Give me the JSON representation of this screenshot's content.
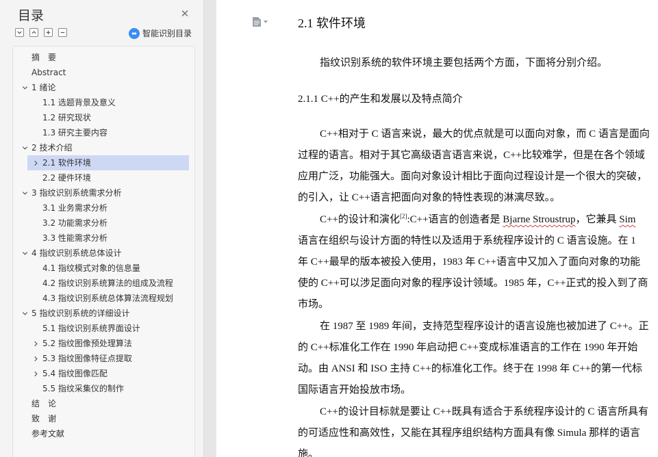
{
  "sidebar": {
    "title": "目录",
    "smart_label": "智能识别目录",
    "items": [
      {
        "label": "摘　要",
        "level": 0,
        "arrow": "none"
      },
      {
        "label": "Abstract",
        "level": 0,
        "arrow": "none"
      },
      {
        "label": "1 绪论",
        "level": 0,
        "arrow": "down"
      },
      {
        "label": "1.1 选题背景及意义",
        "level": 1,
        "arrow": "none"
      },
      {
        "label": "1.2 研究现状",
        "level": 1,
        "arrow": "none"
      },
      {
        "label": "1.3 研究主要内容",
        "level": 1,
        "arrow": "none"
      },
      {
        "label": "2 技术介绍",
        "level": 0,
        "arrow": "down"
      },
      {
        "label": "2.1 软件环境",
        "level": 1,
        "arrow": "right",
        "active": true
      },
      {
        "label": "2.2 硬件环境",
        "level": 1,
        "arrow": "none"
      },
      {
        "label": "3 指纹识别系统需求分析",
        "level": 0,
        "arrow": "down"
      },
      {
        "label": "3.1 业务需求分析",
        "level": 1,
        "arrow": "none"
      },
      {
        "label": "3.2 功能需求分析",
        "level": 1,
        "arrow": "none"
      },
      {
        "label": "3.3 性能需求分析",
        "level": 1,
        "arrow": "none"
      },
      {
        "label": "4 指纹识别系统总体设计",
        "level": 0,
        "arrow": "down"
      },
      {
        "label": "4.1 指纹模式对象的信息量",
        "level": 1,
        "arrow": "none"
      },
      {
        "label": "4.2 指纹识别系统算法的组成及流程",
        "level": 1,
        "arrow": "none"
      },
      {
        "label": "4.3 指纹识别系统总体算法流程规划",
        "level": 1,
        "arrow": "none"
      },
      {
        "label": "5 指纹识别系统的详细设计",
        "level": 0,
        "arrow": "down"
      },
      {
        "label": "5.1 指纹识别系统界面设计",
        "level": 1,
        "arrow": "none"
      },
      {
        "label": "5.2 指纹图像预处理算法",
        "level": 1,
        "arrow": "right"
      },
      {
        "label": "5.3 指纹图像特征点提取",
        "level": 1,
        "arrow": "right"
      },
      {
        "label": "5.4 指纹图像匹配",
        "level": 1,
        "arrow": "right"
      },
      {
        "label": "5.5 指纹采集仪的制作",
        "level": 1,
        "arrow": "none"
      },
      {
        "label": "结　论",
        "level": 0,
        "arrow": "none"
      },
      {
        "label": "致　谢",
        "level": 0,
        "arrow": "none"
      },
      {
        "label": "参考文献",
        "level": 0,
        "arrow": "none"
      }
    ]
  },
  "doc": {
    "heading": "2.1 软件环境",
    "intro": "指纹识别系统的软件环境主要包括两个方面，下面将分别介绍。",
    "subheading": "2.1.1 C++的产生和发展以及特点简介",
    "lines": [
      "C++相对于 C 语言来说，最大的优点就是可以面向对象，而 C 语言是面向",
      "过程的语言。相对于其它高级语言语言来说，C++比较难学，但是在各个领域",
      "应用广泛，功能强大。面向对象设计相比于面向过程设计是一个很大的突破，",
      "的引入，让 C++语言把面向对象的特性表现的淋漓尽致。。",
      "",
      "语言在组织与设计方面的特性以及适用于系统程序设计的 C 语言设施。在 1",
      "年 C++最早的版本被投入使用，1983 年 C++语言中又加入了面向对象的功能",
      "使的 C++可以涉足面向对象的程序设计领域。1985 年，C++正式的投入到了商",
      "市场。",
      "在 1987 至 1989 年间，支持范型程序设计的语言设施也被加进了 C++。正",
      "的 C++标准化工作在 1990 年启动把 C++变成标准语言的工作在 1990 年开始",
      "动。由 ANSI 和 ISO 主持 C++的标准化工作。终于在 1998 年 C++的第一代标",
      "国际语言开始投放市场。",
      "",
      "的可适应性和高效性，又能在其程序组织结构方面具有像 Simula 那样的语言",
      "施。"
    ],
    "line5_prefix": "C++的设计和演化",
    "line5_sup": "[2]",
    "line5_mid": ":C++语言的创造者是 ",
    "line5_name": "Bjarne Stroustrup",
    "line5_suffix": "，它兼具 ",
    "line5_tail": "Sim",
    "line14_prefix": "C++的设计目标就是要让 C++既具有适合于系统程序设计的 C 语言所具有"
  }
}
